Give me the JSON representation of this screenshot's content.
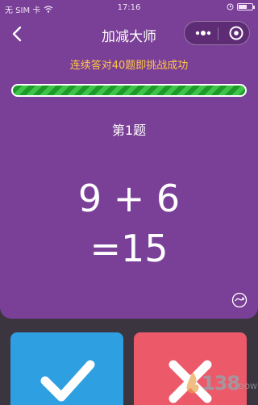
{
  "status": {
    "carrier": "无 SIM 卡",
    "time": "17:16"
  },
  "nav": {
    "title": "加减大师"
  },
  "game": {
    "goal_text": "连续答对40题即挑战成功",
    "progress": 1.0,
    "question_label": "第1题",
    "expression": "9 + 6",
    "result": "=15"
  },
  "buttons": {
    "correct_icon": "check-icon",
    "wrong_icon": "cross-icon"
  },
  "watermark": {
    "text": "138",
    "sub": "DOW"
  },
  "colors": {
    "background": "#7a3f97",
    "goal": "#ffc646",
    "progress": "#2aaa35",
    "correct": "#2e9fe0",
    "wrong": "#ec5a6a"
  }
}
